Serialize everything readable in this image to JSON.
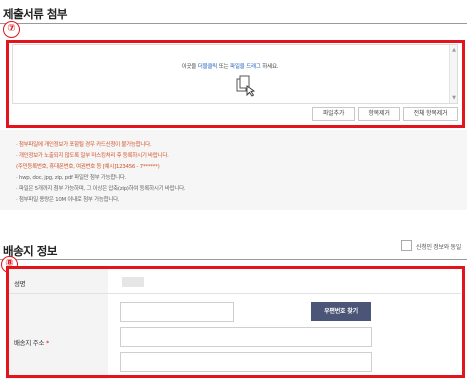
{
  "attachments": {
    "section_title": "제출서류 첨부",
    "marker": "⑦",
    "drop_prefix": "이곳을 ",
    "drop_link1": "더블클릭",
    "drop_mid": " 또는 ",
    "drop_link2": "파일을 드래그",
    "drop_suffix": " 하세요.",
    "drop_icon": "file-add-icon",
    "buttons": {
      "add": "파일추가",
      "remove": "항목제거",
      "remove_all": "전체 항목제거"
    },
    "notes": [
      "· 첨부파일에 개인정보가 포함될 경우 카드신청이 불가능합니다.",
      "· 개인정보가 노출되지 않도록 일부 마스킹처리 후 등록하시기 바랍니다.",
      "  (주민등록번호, 휴대폰번호, 여권번호 등 [예시]123456 - 7******)",
      "· hwp, doc, jpg, zip, pdf 파일만 첨부 가능합니다.",
      "· 파일은 5개까지 첨부 가능하며, 그 이상은 압축(zip)하여 등록하시기 바랍니다.",
      "· 첨부파일 용량은 10M 이내로 첨부 가능합니다."
    ]
  },
  "shipping": {
    "section_title": "배송지 정보",
    "marker": "⑧",
    "same_as_applicant": "신청인 정보와 동일",
    "name_label": "성명",
    "address_label": "배송지 주소",
    "required_mark": "*",
    "zip_button": "우편번호 찾기"
  },
  "colors": {
    "marker_red": "#e4141c",
    "link_blue": "#1f5fb8",
    "warn_orange": "#d2542a",
    "zip_button": "#4a5578"
  }
}
